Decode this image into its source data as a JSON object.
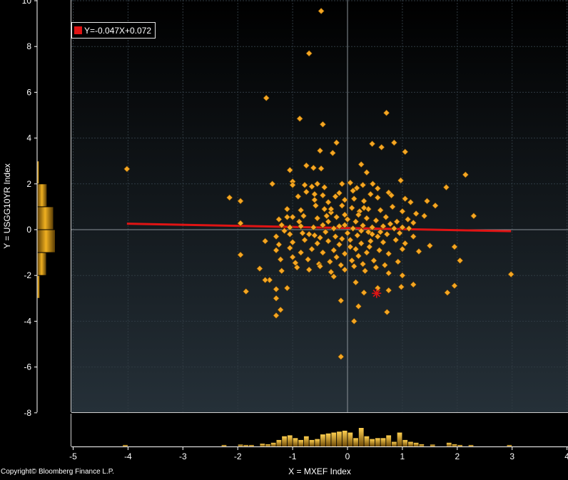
{
  "chart_data": {
    "type": "scatter",
    "xlabel": "X = MXEF Index",
    "ylabel": "Y = USGG10YR Index",
    "xlim": [
      -5,
      4
    ],
    "ylim": [
      -8,
      10
    ],
    "x_ticks": [
      "-5",
      "-4",
      "-3",
      "-2",
      "-1",
      "0",
      "1",
      "2",
      "3",
      "4"
    ],
    "y_ticks": [
      "-8",
      "-6",
      "-4",
      "-2",
      "0",
      "2",
      "4",
      "6",
      "8",
      "10"
    ],
    "grid": true,
    "legend_position": "top-left",
    "regression": {
      "label": "Y=-0.047X+0.072",
      "slope": -0.047,
      "intercept": 0.072,
      "x_range": [
        -4.02,
        2.98
      ],
      "color": "#e01414"
    },
    "highlight_point": {
      "x": 0.53,
      "y": -2.78,
      "color": "#e01414"
    },
    "point_color": "#f5a623",
    "points": [
      [
        -4.02,
        2.65
      ],
      [
        -1.48,
        5.75
      ],
      [
        -0.48,
        9.55
      ],
      [
        -0.7,
        7.7
      ],
      [
        0.71,
        5.1
      ],
      [
        -0.87,
        4.85
      ],
      [
        -0.45,
        4.6
      ],
      [
        0.45,
        3.75
      ],
      [
        0.62,
        3.6
      ],
      [
        0.85,
        3.8
      ],
      [
        -0.5,
        3.45
      ],
      [
        -0.2,
        3.8
      ],
      [
        -0.27,
        3.35
      ],
      [
        1.05,
        3.4
      ],
      [
        -1.05,
        2.6
      ],
      [
        -0.62,
        2.7
      ],
      [
        -0.48,
        2.67
      ],
      [
        -0.75,
        2.8
      ],
      [
        0.25,
        2.85
      ],
      [
        0.35,
        2.5
      ],
      [
        2.15,
        2.4
      ],
      [
        -1.37,
        2.0
      ],
      [
        -1.0,
        2.1
      ],
      [
        -1.0,
        1.95
      ],
      [
        -0.78,
        1.95
      ],
      [
        -0.65,
        1.88
      ],
      [
        -0.55,
        2.0
      ],
      [
        -0.42,
        1.85
      ],
      [
        -0.15,
        1.6
      ],
      [
        0.05,
        2.05
      ],
      [
        0.17,
        1.82
      ],
      [
        0.28,
        1.95
      ],
      [
        0.46,
        2.0
      ],
      [
        0.75,
        1.62
      ],
      [
        0.97,
        2.15
      ],
      [
        1.8,
        1.85
      ],
      [
        -2.15,
        1.4
      ],
      [
        -1.95,
        1.25
      ],
      [
        -0.9,
        1.45
      ],
      [
        -0.75,
        1.65
      ],
      [
        -0.6,
        1.3
      ],
      [
        -0.35,
        1.2
      ],
      [
        -0.22,
        1.45
      ],
      [
        -0.05,
        1.3
      ],
      [
        0.12,
        1.35
      ],
      [
        0.3,
        1.25
      ],
      [
        0.55,
        1.4
      ],
      [
        0.8,
        1.5
      ],
      [
        1.05,
        1.35
      ],
      [
        1.15,
        1.2
      ],
      [
        1.45,
        1.25
      ],
      [
        1.6,
        1.05
      ],
      [
        -1.1,
        0.9
      ],
      [
        -0.85,
        0.85
      ],
      [
        -0.58,
        1.05
      ],
      [
        -0.42,
        0.9
      ],
      [
        -0.3,
        0.75
      ],
      [
        -0.1,
        1.05
      ],
      [
        0.08,
        0.95
      ],
      [
        0.22,
        0.8
      ],
      [
        0.38,
        0.9
      ],
      [
        0.6,
        0.85
      ],
      [
        0.82,
        1.0
      ],
      [
        1.0,
        0.8
      ],
      [
        1.25,
        0.7
      ],
      [
        1.4,
        0.6
      ],
      [
        2.3,
        0.6
      ],
      [
        -1.25,
        0.45
      ],
      [
        -1.0,
        0.55
      ],
      [
        -0.8,
        0.6
      ],
      [
        -0.55,
        0.5
      ],
      [
        -0.35,
        0.35
      ],
      [
        -0.2,
        0.55
      ],
      [
        0.0,
        0.45
      ],
      [
        0.15,
        0.35
      ],
      [
        0.35,
        0.5
      ],
      [
        0.52,
        0.4
      ],
      [
        0.7,
        0.55
      ],
      [
        0.9,
        0.35
      ],
      [
        1.1,
        0.45
      ],
      [
        -1.95,
        0.28
      ],
      [
        -1.2,
        0.2
      ],
      [
        -1.05,
        0.1
      ],
      [
        -0.85,
        0.15
      ],
      [
        -0.62,
        0.1
      ],
      [
        -0.45,
        0.2
      ],
      [
        -0.25,
        0.05
      ],
      [
        -0.05,
        0.2
      ],
      [
        0.1,
        0.05
      ],
      [
        0.28,
        0.18
      ],
      [
        0.45,
        0.1
      ],
      [
        0.65,
        0.15
      ],
      [
        0.85,
        0.05
      ],
      [
        1.0,
        0.1
      ],
      [
        -1.3,
        -0.3
      ],
      [
        -1.05,
        -0.2
      ],
      [
        -0.82,
        -0.15
      ],
      [
        -0.6,
        -0.25
      ],
      [
        -0.4,
        -0.1
      ],
      [
        -0.22,
        -0.3
      ],
      [
        0.0,
        -0.15
      ],
      [
        0.18,
        -0.25
      ],
      [
        0.38,
        -0.1
      ],
      [
        0.55,
        -0.3
      ],
      [
        0.72,
        -0.2
      ],
      [
        0.95,
        -0.15
      ],
      [
        1.2,
        -0.3
      ],
      [
        -1.5,
        -0.5
      ],
      [
        -1.25,
        -0.65
      ],
      [
        -1.0,
        -0.55
      ],
      [
        -0.78,
        -0.45
      ],
      [
        -0.55,
        -0.6
      ],
      [
        -0.35,
        -0.5
      ],
      [
        -0.15,
        -0.65
      ],
      [
        0.05,
        -0.45
      ],
      [
        0.25,
        -0.6
      ],
      [
        0.42,
        -0.5
      ],
      [
        0.65,
        -0.55
      ],
      [
        0.88,
        -0.45
      ],
      [
        1.05,
        -0.6
      ],
      [
        1.5,
        -0.7
      ],
      [
        1.95,
        -0.75
      ],
      [
        -1.95,
        -1.1
      ],
      [
        -1.3,
        -0.9
      ],
      [
        -1.05,
        -0.8
      ],
      [
        -0.85,
        -1.0
      ],
      [
        -0.65,
        -0.85
      ],
      [
        -0.45,
        -1.0
      ],
      [
        -0.25,
        -0.9
      ],
      [
        -0.05,
        -1.05
      ],
      [
        0.15,
        -0.85
      ],
      [
        0.35,
        -1.0
      ],
      [
        0.58,
        -0.9
      ],
      [
        0.75,
        -1.05
      ],
      [
        1.0,
        -0.85
      ],
      [
        -1.6,
        -1.7
      ],
      [
        -1.22,
        -1.3
      ],
      [
        -0.95,
        -1.45
      ],
      [
        -0.72,
        -1.3
      ],
      [
        -0.52,
        -1.5
      ],
      [
        -0.32,
        -1.4
      ],
      [
        -0.12,
        -1.55
      ],
      [
        0.08,
        -1.35
      ],
      [
        0.28,
        -1.5
      ],
      [
        0.48,
        -1.35
      ],
      [
        0.68,
        -1.55
      ],
      [
        0.92,
        -1.4
      ],
      [
        2.05,
        -1.35
      ],
      [
        -1.42,
        -2.2
      ],
      [
        -1.2,
        -1.8
      ],
      [
        -0.92,
        -1.65
      ],
      [
        -0.7,
        -1.75
      ],
      [
        -0.5,
        -1.6
      ],
      [
        -0.3,
        -1.85
      ],
      [
        -0.05,
        -1.75
      ],
      [
        0.12,
        -1.6
      ],
      [
        0.32,
        -1.8
      ],
      [
        0.52,
        -1.65
      ],
      [
        0.75,
        -1.9
      ],
      [
        1.0,
        -2.0
      ],
      [
        -1.85,
        -2.7
      ],
      [
        -1.5,
        -2.2
      ],
      [
        -1.3,
        -2.6
      ],
      [
        -1.1,
        -2.55
      ],
      [
        -0.25,
        -2.05
      ],
      [
        0.15,
        -2.3
      ],
      [
        0.3,
        -2.75
      ],
      [
        0.55,
        -2.55
      ],
      [
        0.75,
        -2.65
      ],
      [
        0.98,
        -2.5
      ],
      [
        1.2,
        -2.4
      ],
      [
        1.82,
        -2.75
      ],
      [
        1.95,
        -2.45
      ],
      [
        2.98,
        -1.95
      ],
      [
        -1.3,
        -3.0
      ],
      [
        -1.22,
        -3.5
      ],
      [
        -1.3,
        -3.75
      ],
      [
        -0.12,
        -3.1
      ],
      [
        0.2,
        -3.35
      ],
      [
        0.72,
        -3.6
      ],
      [
        0.12,
        -4.0
      ],
      [
        -0.12,
        -5.55
      ],
      [
        -0.1,
        -0.4
      ],
      [
        0.45,
        -0.2
      ],
      [
        -0.5,
        -0.35
      ],
      [
        0.2,
        0.65
      ],
      [
        -0.7,
        -0.2
      ],
      [
        0.6,
        -0.1
      ],
      [
        -0.05,
        0.65
      ],
      [
        0.05,
        -0.75
      ],
      [
        -0.38,
        0.6
      ],
      [
        0.4,
        -0.75
      ],
      [
        -0.15,
        0.15
      ],
      [
        0.25,
        -0.05
      ],
      [
        -0.88,
        0.35
      ],
      [
        0.78,
        0.25
      ],
      [
        -1.15,
        -0.05
      ],
      [
        1.12,
        0.05
      ],
      [
        -0.6,
        1.55
      ],
      [
        0.55,
        1.8
      ],
      [
        -0.2,
        -1.2
      ],
      [
        0.2,
        -1.15
      ],
      [
        -1.0,
        -1.2
      ],
      [
        1.3,
        -0.95
      ],
      [
        -0.45,
        1.5
      ],
      [
        0.42,
        1.55
      ],
      [
        -0.1,
        2.0
      ],
      [
        0.1,
        1.7
      ],
      [
        -1.1,
        0.55
      ],
      [
        1.2,
        0.3
      ],
      [
        0.3,
        0.95
      ],
      [
        -0.3,
        0.9
      ]
    ],
    "y_distribution": [
      {
        "y_from": -3,
        "y_to": -2,
        "value": 0.7
      },
      {
        "y_from": -2,
        "y_to": -1,
        "value": 2.55
      },
      {
        "y_from": -1,
        "y_to": 0,
        "value": 5.05
      },
      {
        "y_from": 0,
        "y_to": 1,
        "value": 4.55
      },
      {
        "y_from": 1,
        "y_to": 2,
        "value": 2.7
      },
      {
        "y_from": 2,
        "y_to": 3,
        "value": 0.5
      }
    ],
    "x_distribution": [
      {
        "x": -4.05,
        "v": 0.08
      },
      {
        "x": -2.25,
        "v": 0.08
      },
      {
        "x": -1.95,
        "v": 0.1
      },
      {
        "x": -1.85,
        "v": 0.08
      },
      {
        "x": -1.75,
        "v": 0.08
      },
      {
        "x": -1.55,
        "v": 0.15
      },
      {
        "x": -1.45,
        "v": 0.12
      },
      {
        "x": -1.35,
        "v": 0.2
      },
      {
        "x": -1.25,
        "v": 0.35
      },
      {
        "x": -1.15,
        "v": 0.55
      },
      {
        "x": -1.05,
        "v": 0.6
      },
      {
        "x": -0.95,
        "v": 0.45
      },
      {
        "x": -0.85,
        "v": 0.35
      },
      {
        "x": -0.75,
        "v": 0.55
      },
      {
        "x": -0.65,
        "v": 0.35
      },
      {
        "x": -0.55,
        "v": 0.4
      },
      {
        "x": -0.45,
        "v": 0.65
      },
      {
        "x": -0.35,
        "v": 0.7
      },
      {
        "x": -0.25,
        "v": 0.75
      },
      {
        "x": -0.15,
        "v": 0.8
      },
      {
        "x": -0.05,
        "v": 0.85
      },
      {
        "x": 0.05,
        "v": 0.75
      },
      {
        "x": 0.15,
        "v": 0.45
      },
      {
        "x": 0.25,
        "v": 1.0
      },
      {
        "x": 0.35,
        "v": 0.55
      },
      {
        "x": 0.45,
        "v": 0.4
      },
      {
        "x": 0.55,
        "v": 0.45
      },
      {
        "x": 0.65,
        "v": 0.45
      },
      {
        "x": 0.75,
        "v": 0.6
      },
      {
        "x": 0.85,
        "v": 0.25
      },
      {
        "x": 0.95,
        "v": 0.75
      },
      {
        "x": 1.05,
        "v": 0.35
      },
      {
        "x": 1.15,
        "v": 0.25
      },
      {
        "x": 1.25,
        "v": 0.2
      },
      {
        "x": 1.35,
        "v": 0.12
      },
      {
        "x": 1.55,
        "v": 0.1
      },
      {
        "x": 1.85,
        "v": 0.2
      },
      {
        "x": 1.95,
        "v": 0.12
      },
      {
        "x": 2.05,
        "v": 0.08
      },
      {
        "x": 2.25,
        "v": 0.08
      },
      {
        "x": 2.95,
        "v": 0.08
      }
    ]
  },
  "legend_label": "Y=-0.047X+0.072",
  "copyright": "Copyright© Bloomberg Finance L.P."
}
